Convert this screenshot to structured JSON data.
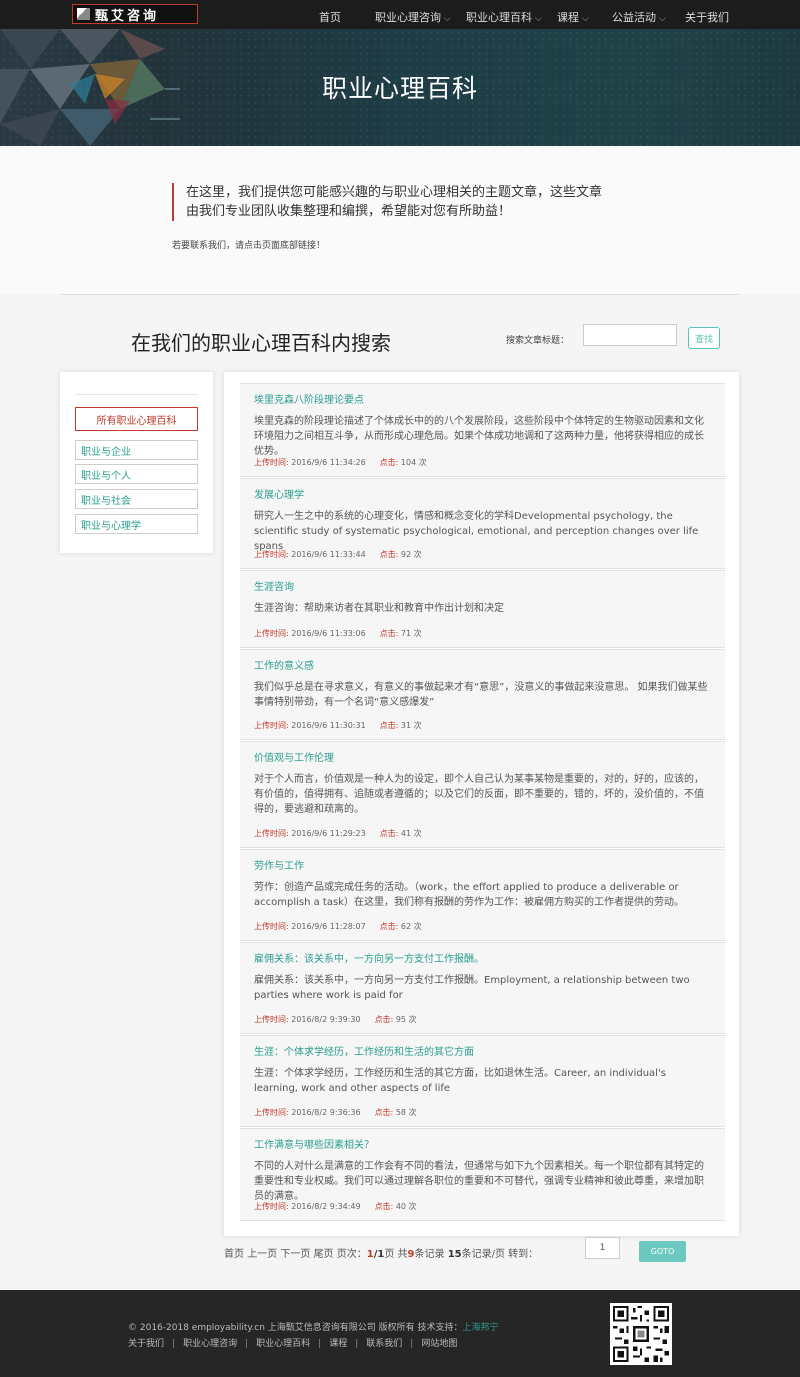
{
  "header": {
    "logo_text": "甄艾咨询",
    "nav": [
      {
        "label": "首页",
        "dropdown": false
      },
      {
        "label": "职业心理咨询",
        "dropdown": true
      },
      {
        "label": "职业心理百科",
        "dropdown": true
      },
      {
        "label": "课程",
        "dropdown": true
      },
      {
        "label": "公益活动",
        "dropdown": true
      },
      {
        "label": "关于我们",
        "dropdown": false
      }
    ]
  },
  "banner": {
    "title": "职业心理百科"
  },
  "intro": {
    "quote_line1": "在这里，我们提供您可能感兴趣的与职业心理相关的主题文章，这些文章",
    "quote_line2": "由我们专业团队收集整理和编撰，希望能对您有所助益！",
    "contact": "若要联系我们，请点击页面底部链接！"
  },
  "search": {
    "title": "在我们的职业心理百科内搜索",
    "label": "搜索文章标题：",
    "input_value": "",
    "button": "查找"
  },
  "sidebar": {
    "all": "所有职业心理百科",
    "categories": [
      "职业与企业",
      "职业与个人",
      "职业与社会",
      "职业与心理学"
    ]
  },
  "meta_labels": {
    "upload": "上传时间:",
    "clicks": "点击:",
    "times": "次"
  },
  "articles": [
    {
      "title": "埃里克森八阶段理论要点",
      "desc": "埃里克森的阶段理论描述了个体成长中的的八个发展阶段，这些阶段中个体特定的生物驱动因素和文化环境阻力之间相互斗争，从而形成心理危局。如果个体成功地调和了这两种力量，他将获得相应的成长优势。",
      "time": "2016/9/6 11:34:26",
      "clicks": "104"
    },
    {
      "title": "发展心理学",
      "desc": "研究人一生之中的系统的心理变化，情感和概念变化的学科Developmental psychology, the scientific study of systematic psychological, emotional, and perception changes over life spans",
      "time": "2016/9/6 11:33:44",
      "clicks": "92"
    },
    {
      "title": "生涯咨询",
      "desc": "生涯咨询：帮助来访者在其职业和教育中作出计划和决定",
      "time": "2016/9/6 11:33:06",
      "clicks": "71"
    },
    {
      "title": "工作的意义感",
      "desc": "我们似乎总是在寻求意义，有意义的事做起来才有“意思”，没意义的事做起来没意思。 如果我们做某些事情特别带劲，有一个名词“意义感爆发”",
      "time": "2016/9/6 11:30:31",
      "clicks": "31"
    },
    {
      "title": "价值观与工作伦理",
      "desc": "对于个人而言，价值观是一种人为的设定，即个人自己认为某事某物是重要的，对的，好的，应该的，有价值的，值得拥有、追随或者遵循的；以及它们的反面，即不重要的，错的，坏的，没价值的，不值得的，要逃避和疏离的。",
      "time": "2016/9/6 11:29:23",
      "clicks": "41"
    },
    {
      "title": "劳作与工作",
      "desc": "劳作：创造产品或完成任务的活动。（work，the effort applied to produce a deliverable or accomplish a task）在这里，我们称有报酬的劳作为工作：被雇佣方购买的工作者提供的劳动。",
      "time": "2016/9/6 11:28:07",
      "clicks": "62"
    },
    {
      "title": "雇佣关系：该关系中，一方向另一方支付工作报酬。",
      "desc": "雇佣关系：该关系中，一方向另一方支付工作报酬。Employment, a relationship between two parties where work is paid for",
      "time": "2016/8/2 9:39:30",
      "clicks": "95"
    },
    {
      "title": "生涯：个体求学经历，工作经历和生活的其它方面",
      "desc": "生涯：个体求学经历，工作经历和生活的其它方面，比如退休生活。Career, an individual's learning, work and other aspects of life",
      "time": "2016/8/2 9:36:36",
      "clicks": "58"
    },
    {
      "title": "工作满意与哪些因素相关？",
      "desc": "不同的人对什么是满意的工作会有不同的看法，但通常与如下九个因素相关。每一个职位都有其特定的重要性和专业权威。我们可以通过理解各职位的重要和不可替代，强调专业精神和彼此尊重，来增加职员的满意。",
      "time": "2016/8/2 9:34:49",
      "clicks": "40"
    }
  ],
  "pager": {
    "first": "首页",
    "prev": "上一页",
    "next": "下一页",
    "last": "尾页",
    "page_label": "页次：",
    "current": "1",
    "total_pages": "1",
    "page_suffix": "页",
    "total_prefix": "共",
    "total_records": "9",
    "records_suffix": "条记录",
    "per_page": "15",
    "per_page_suffix": "条记录/页",
    "goto_label": "转到：",
    "input_value": "1",
    "goto_button": "GOTO"
  },
  "footer": {
    "copyright": "© 2016-2018 employability.cn 上海甄艾信息咨询有限公司 版权所有 技术支持：",
    "support": "上海邦宁",
    "links": [
      "关于我们",
      "职业心理咨询",
      "职业心理百科",
      "课程",
      "联系我们",
      "网站地图"
    ]
  },
  "colors": {
    "accent_teal": "#2a9d8f",
    "accent_red": "#c0392b",
    "goto_bg": "#6cc9c0"
  }
}
